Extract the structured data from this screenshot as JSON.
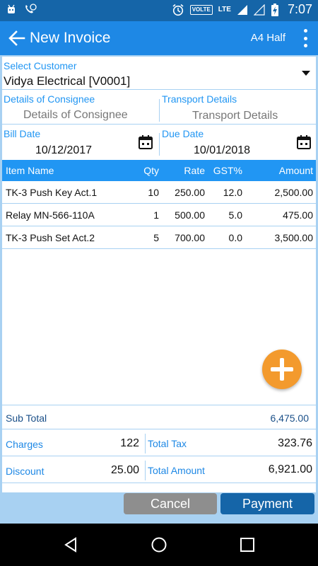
{
  "status_bar": {
    "time": "7:07",
    "volte": "VOLTE",
    "network": "LTE"
  },
  "appbar": {
    "title": "New Invoice",
    "layout_label": "A4 Half"
  },
  "customer": {
    "label": "Select Customer",
    "value": "Vidya Electrical [V0001]"
  },
  "consignee": {
    "label": "Details of Consignee",
    "placeholder": "Details of Consignee"
  },
  "transport": {
    "label": "Transport Details",
    "placeholder": "Transport Details"
  },
  "bill_date": {
    "label": "Bill Date",
    "value": "10/12/2017"
  },
  "due_date": {
    "label": "Due Date",
    "value": "10/01/2018"
  },
  "table": {
    "headers": {
      "name": "Item Name",
      "qty": "Qty",
      "rate": "Rate",
      "gst": "GST%",
      "amount": "Amount"
    },
    "rows": [
      {
        "name": "TK-3 Push Key Act.1",
        "qty": "10",
        "rate": "250.00",
        "gst": "12.0",
        "amount": "2,500.00"
      },
      {
        "name": "Relay MN-566-110A",
        "qty": "1",
        "rate": "500.00",
        "gst": "5.0",
        "amount": "475.00"
      },
      {
        "name": "TK-3 Push Set Act.2",
        "qty": "5",
        "rate": "700.00",
        "gst": "0.0",
        "amount": "3,500.00"
      }
    ]
  },
  "summary": {
    "subtotal_label": "Sub Total",
    "subtotal_value": "6,475.00",
    "charges_label": "Charges",
    "charges_value": "122",
    "total_tax_label": "Total Tax",
    "total_tax_value": "323.76",
    "discount_label": "Discount",
    "discount_value": "25.00",
    "total_amount_label": "Total Amount",
    "total_amount_value": "6,921.00"
  },
  "actions": {
    "cancel_label": "Cancel",
    "payment_label": "Payment"
  },
  "colors": {
    "status_bar": "#1565a8",
    "app_bar": "#1e88e5",
    "table_header": "#2196f3",
    "fab": "#f39a2d",
    "cancel_button": "#8e8e8e",
    "payment_button": "#1565a8"
  }
}
